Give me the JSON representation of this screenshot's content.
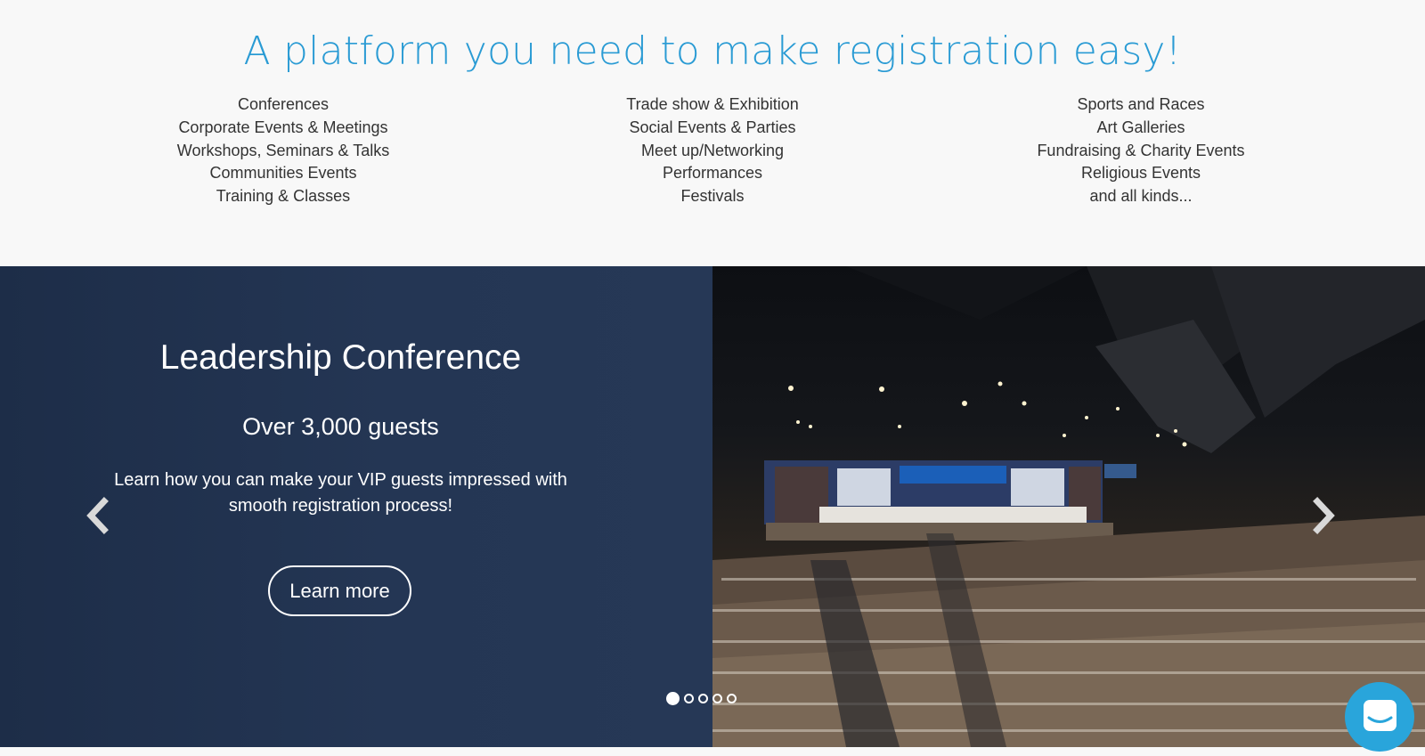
{
  "headline": {
    "text": "A platform you need to make registration easy!",
    "color": "#2a9bd4"
  },
  "event_types": {
    "column_1": [
      "Conferences",
      "Corporate Events & Meetings",
      "Workshops, Seminars & Talks",
      "Communities Events",
      "Training & Classes"
    ],
    "column_2": [
      "Trade show & Exhibition",
      "Social Events & Parties",
      "Meet up/Networking",
      "Performances",
      "Festivals"
    ],
    "column_3": [
      "Sports and Races",
      "Art Galleries",
      "Fundraising & Charity Events",
      "Religious Events",
      "and all kinds..."
    ]
  },
  "carousel": {
    "title": "Leadership Conference",
    "subtitle": "Over 3,000 guests",
    "description": "Learn how you can make your VIP guests impressed with smooth registration process!",
    "button_label": "Learn more",
    "slide_count": 5,
    "active_slide": 1,
    "prev_icon": "chevron-left-icon",
    "next_icon": "chevron-right-icon",
    "image": "conference-hall-photo"
  },
  "chat": {
    "icon": "chat-bubble-icon",
    "color": "#29a5db"
  }
}
